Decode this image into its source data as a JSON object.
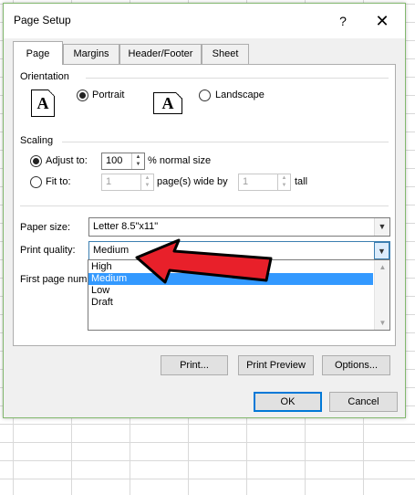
{
  "dialog": {
    "title": "Page Setup",
    "help_label": "?",
    "close_label": "✕"
  },
  "tabs": [
    "Page",
    "Margins",
    "Header/Footer",
    "Sheet"
  ],
  "orientation": {
    "group_label": "Orientation",
    "portrait_label": "Portrait",
    "landscape_label": "Landscape",
    "icon_glyph": "A",
    "selected": "Portrait"
  },
  "scaling": {
    "group_label": "Scaling",
    "adjust_label": "Adjust to:",
    "adjust_value": "100",
    "adjust_suffix": "% normal size",
    "fit_label": "Fit to:",
    "fit_wide_value": "1",
    "fit_wide_suffix": "page(s) wide by",
    "fit_tall_value": "1",
    "fit_tall_suffix": "tall",
    "selected": "Adjust to"
  },
  "paper_size": {
    "label": "Paper size:",
    "value": "Letter 8.5\"x11\""
  },
  "print_quality": {
    "label": "Print quality:",
    "value": "Medium",
    "options": [
      "High",
      "Medium",
      "Low",
      "Draft"
    ],
    "selected_index": 1
  },
  "first_page_number": {
    "label": "First page num"
  },
  "buttons": {
    "print": "Print...",
    "print_preview": "Print Preview",
    "options": "Options...",
    "ok": "OK",
    "cancel": "Cancel"
  },
  "colors": {
    "selection": "#3399ff",
    "annotation_arrow": "#e8202a",
    "dialog_border": "#83b86f"
  }
}
